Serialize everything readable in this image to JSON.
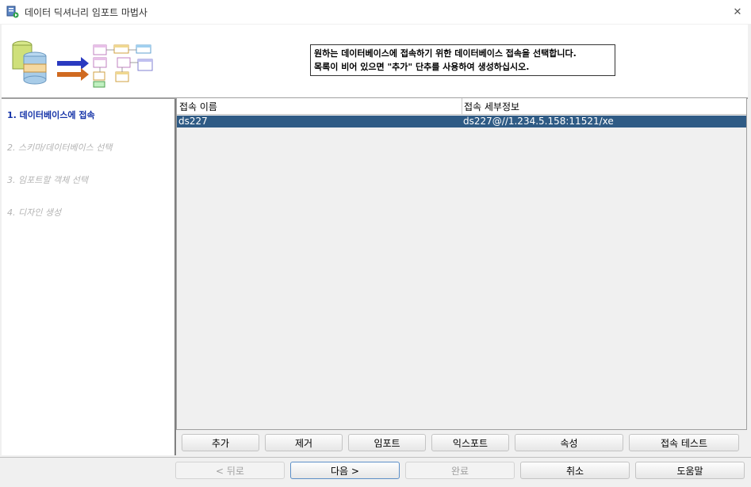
{
  "window": {
    "title": "데이터 딕셔너리 임포트 마법사",
    "close_glyph": "✕"
  },
  "header": {
    "instruction_line1": "원하는 데이터베이스에 접속하기 위한 데이터베이스 접속을 선택합니다.",
    "instruction_line2": "목록이 비어 있으면 \"추가\" 단추를 사용하여 생성하십시오."
  },
  "steps": [
    {
      "label": "1. 데이터베이스에 접속",
      "active": true
    },
    {
      "label": "2. 스키마/데이터베이스 선택",
      "active": false
    },
    {
      "label": "3. 임포트할 객체 선택",
      "active": false
    },
    {
      "label": "4. 디자인 생성",
      "active": false
    }
  ],
  "table": {
    "columns": [
      "접속 이름",
      "접속 세부정보"
    ],
    "rows": [
      {
        "name": "ds227",
        "details": "ds227@//1.234.5.158:11521/xe",
        "selected": true
      }
    ]
  },
  "actions": {
    "add": "추가",
    "remove": "제거",
    "import": "임포트",
    "export": "익스포트",
    "properties": "속성",
    "test": "접속 테스트"
  },
  "nav": {
    "back": "< 뒤로",
    "next": "다음 >",
    "finish": "완료",
    "cancel": "취소",
    "help": "도움말"
  },
  "colors": {
    "selection": "#2f5b85",
    "active_step": "#1533a8",
    "disabled_text": "#a0a0a0"
  }
}
